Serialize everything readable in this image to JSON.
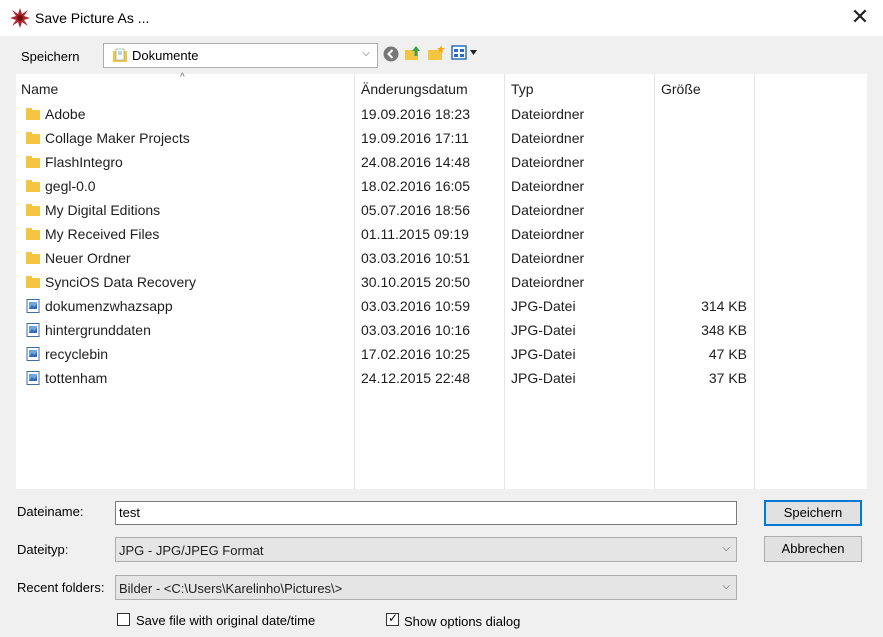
{
  "window": {
    "title": "Save Picture As ...",
    "close": "✕"
  },
  "nav": {
    "save_in_label": "Speichern",
    "location": "Dokumente"
  },
  "columns": {
    "name": "Name",
    "date": "Änderungsdatum",
    "type": "Typ",
    "size": "Größe"
  },
  "files": [
    {
      "name": "Adobe",
      "date": "19.09.2016 18:23",
      "type": "Dateiordner",
      "size": "",
      "kind": "folder"
    },
    {
      "name": "Collage Maker Projects",
      "date": "19.09.2016 17:11",
      "type": "Dateiordner",
      "size": "",
      "kind": "folder"
    },
    {
      "name": "FlashIntegro",
      "date": "24.08.2016 14:48",
      "type": "Dateiordner",
      "size": "",
      "kind": "folder"
    },
    {
      "name": "gegl-0.0",
      "date": "18.02.2016 16:05",
      "type": "Dateiordner",
      "size": "",
      "kind": "folder"
    },
    {
      "name": "My Digital Editions",
      "date": "05.07.2016 18:56",
      "type": "Dateiordner",
      "size": "",
      "kind": "folder"
    },
    {
      "name": "My Received Files",
      "date": "01.11.2015 09:19",
      "type": "Dateiordner",
      "size": "",
      "kind": "folder"
    },
    {
      "name": "Neuer Ordner",
      "date": "03.03.2016 10:51",
      "type": "Dateiordner",
      "size": "",
      "kind": "folder"
    },
    {
      "name": "SynciOS Data Recovery",
      "date": "30.10.2015 20:50",
      "type": "Dateiordner",
      "size": "",
      "kind": "folder"
    },
    {
      "name": "dokumenzwhazsapp",
      "date": "03.03.2016 10:59",
      "type": "JPG-Datei",
      "size": "314 KB",
      "kind": "image"
    },
    {
      "name": "hintergrunddaten",
      "date": "03.03.2016 10:16",
      "type": "JPG-Datei",
      "size": "348 KB",
      "kind": "image"
    },
    {
      "name": "recyclebin",
      "date": "17.02.2016 10:25",
      "type": "JPG-Datei",
      "size": "47 KB",
      "kind": "image"
    },
    {
      "name": "tottenham",
      "date": "24.12.2015 22:48",
      "type": "JPG-Datei",
      "size": "37 KB",
      "kind": "image"
    }
  ],
  "form": {
    "filename_label": "Dateiname:",
    "filename_value": "test",
    "filetype_label": "Dateityp:",
    "filetype_value": "JPG - JPG/JPEG Format",
    "recent_label": "Recent folders:",
    "recent_value": "Bilder  -  <C:\\Users\\Karelinho\\Pictures\\>",
    "save_button": "Speichern",
    "cancel_button": "Abbrechen",
    "keep_date_label": "Save file with original date/time",
    "keep_date_checked": false,
    "show_options_label": "Show options dialog",
    "show_options_checked": true
  },
  "colors": {
    "folder": "#f4c542",
    "accent": "#0078d7",
    "grid": "#e5e5e5"
  },
  "icons": {
    "back": "back-icon",
    "up": "up-folder-icon",
    "new_folder": "new-folder-icon",
    "views": "views-menu-icon"
  }
}
